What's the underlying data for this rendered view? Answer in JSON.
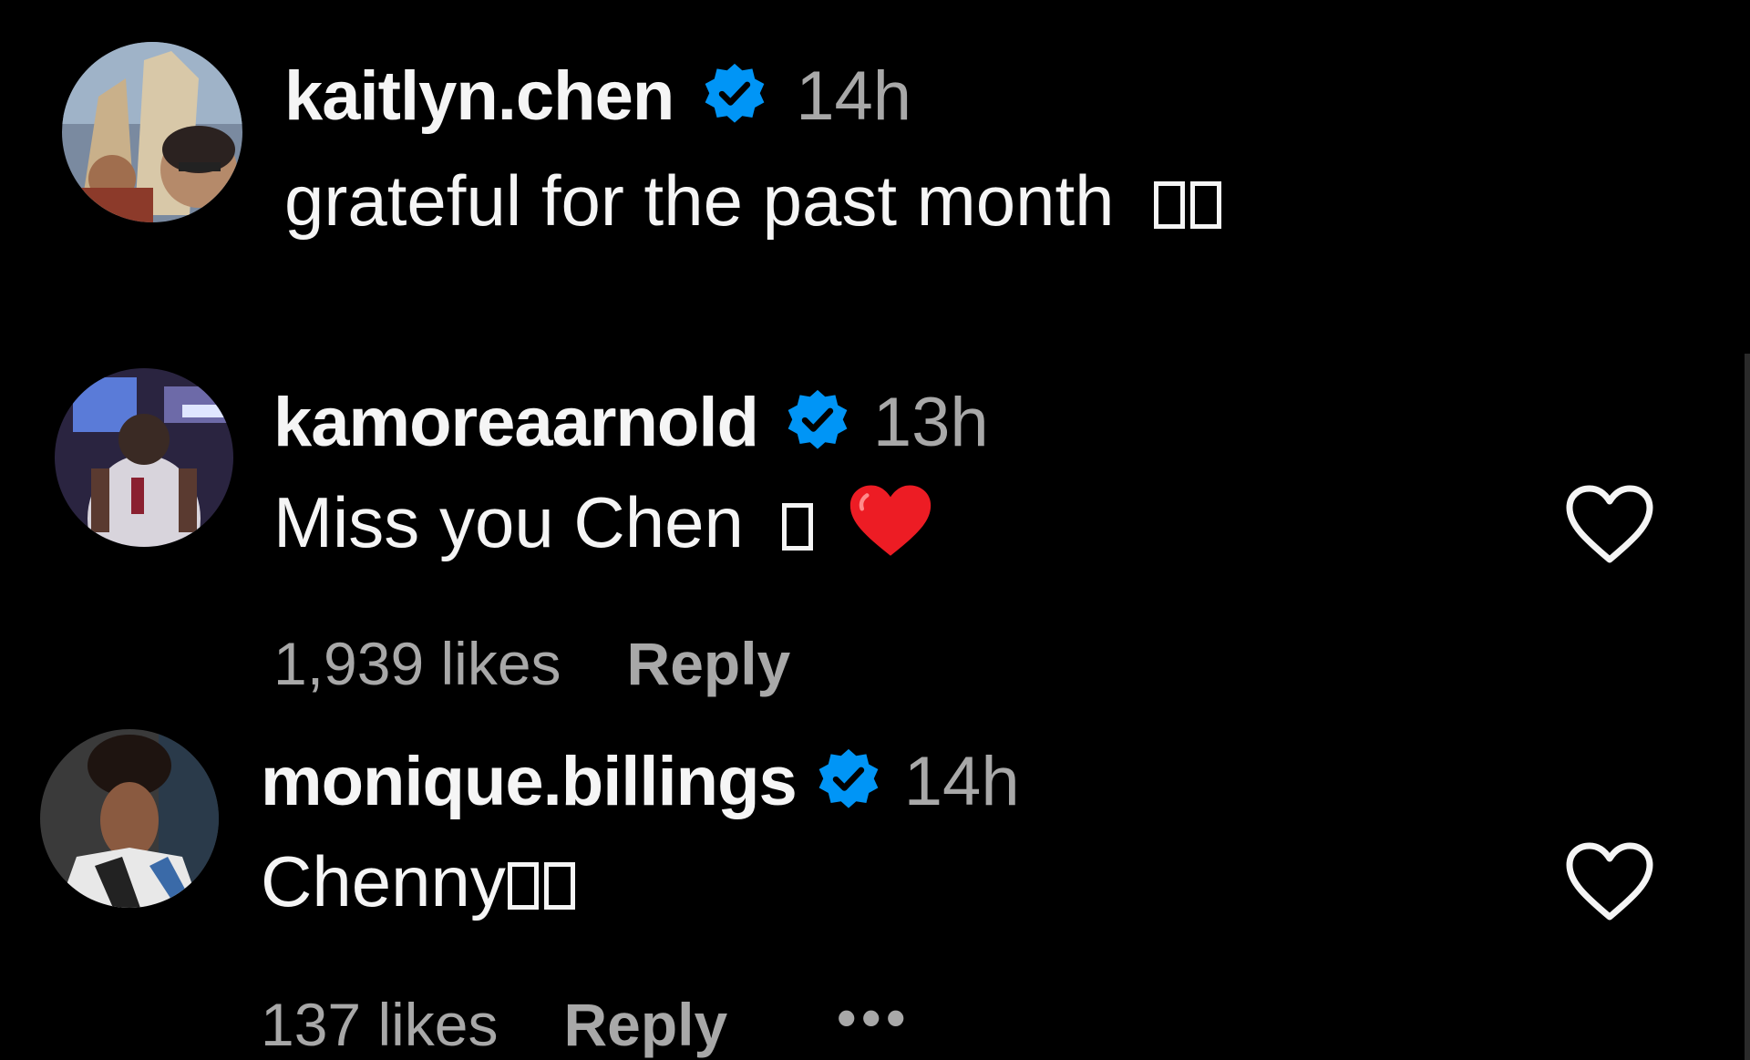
{
  "colors": {
    "background": "#000000",
    "text": "#f5f5f5",
    "muted": "#a8a8a8",
    "verified": "#0095f6",
    "heart": "#ed1c24"
  },
  "comments": [
    {
      "username": "kaitlyn.chen",
      "verified": true,
      "time": "14h",
      "text": "grateful for the past month",
      "glyphs": [
        "□",
        "□"
      ],
      "has_like": false
    },
    {
      "username": "kamoreaarnold",
      "verified": true,
      "time": "13h",
      "text": "Miss you Chen",
      "glyphs": [
        "□"
      ],
      "emoji": "heart-emoji",
      "likes": "1,939 likes",
      "reply": "Reply",
      "has_like": true
    },
    {
      "username": "monique.billings",
      "verified": true,
      "time": "14h",
      "text": "Chenny",
      "glyphs": [
        "□",
        "□"
      ],
      "likes": "137 likes",
      "reply": "Reply",
      "more": "•••",
      "has_like": true
    }
  ],
  "icons": {
    "verified": "verified-badge-icon",
    "like": "heart-outline-icon",
    "more": "more-options-icon"
  }
}
